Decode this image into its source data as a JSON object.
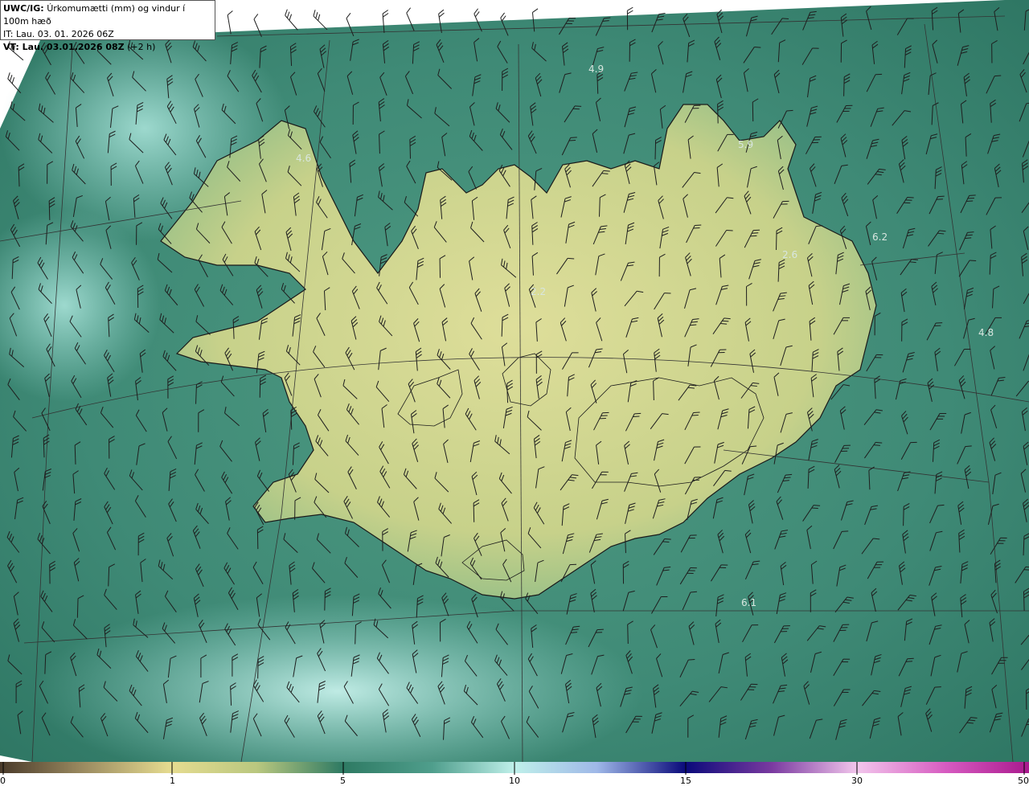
{
  "header": {
    "product": "UWC/IG:",
    "title": "Úrkomumætti (mm) og vindur í 100m hæð",
    "init_time": "IT: Lau. 03. 01. 2026 06Z",
    "valid_prefix": "VT: Lau. 03.01.2026 08Z",
    "valid_offset": "(+2 h)"
  },
  "colorbar": {
    "ticks": [
      "0",
      "1",
      "5",
      "10",
      "15",
      "30",
      "50"
    ]
  },
  "map_labels": [
    "4.9",
    "5.9",
    "4.6",
    "6.2",
    "2.6",
    "2.2",
    "4.8",
    "6.1"
  ],
  "colors": {
    "ocean": "#3f8a76",
    "ocean_light": "#8fd3c8",
    "land": "#c9d38a",
    "land_high": "#dede9a",
    "coast": "#1a1a1a"
  }
}
